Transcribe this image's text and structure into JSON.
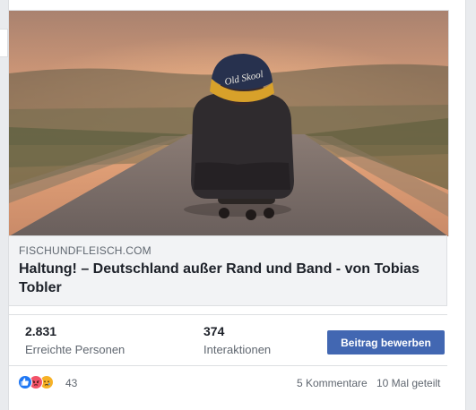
{
  "post": {
    "link": {
      "domain": "FISCHUNDFLEISCH.COM",
      "title": "Haltung! – Deutschland außer Rand und Band - von Tobias Tobler"
    },
    "stats": [
      {
        "value": "2.831",
        "label": "Erreichte Personen"
      },
      {
        "value": "374",
        "label": "Interaktionen"
      }
    ],
    "promote_button": "Beitrag bewerben",
    "reactions": {
      "icons": [
        "like-icon",
        "angry-icon",
        "sad-icon"
      ],
      "count": "43"
    },
    "comments": "5 Kommentare",
    "shares": "10 Mal geteilt"
  },
  "colors": {
    "accent": "#4267b2",
    "like": "#2078f4",
    "angry": "#f25268",
    "sad": "#f7b125"
  }
}
